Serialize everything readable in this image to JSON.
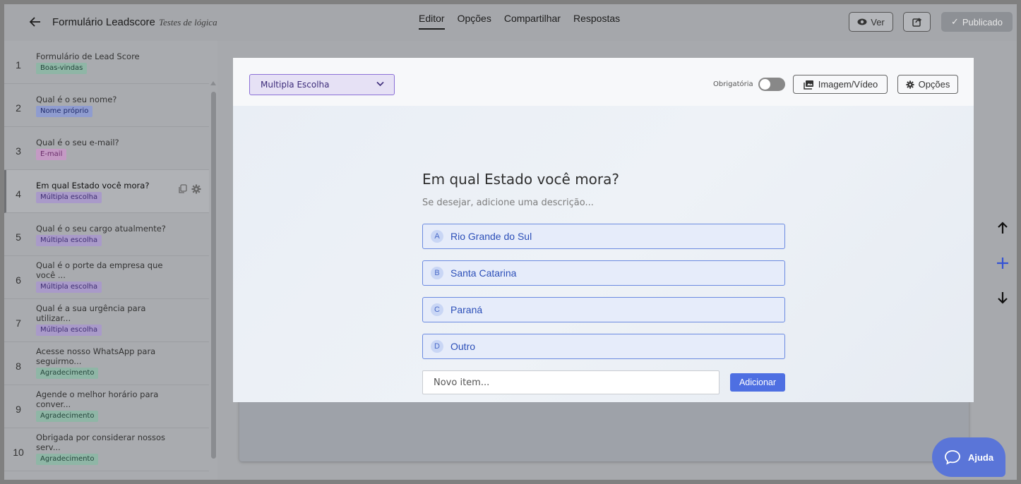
{
  "header": {
    "title": "Formulário Leadscore",
    "subtitle": "Testes de lógica",
    "tabs": [
      {
        "label": "Editor"
      },
      {
        "label": "Opções"
      },
      {
        "label": "Compartilhar"
      },
      {
        "label": "Respostas"
      }
    ],
    "view_label": "Ver",
    "published_label": "Publicado"
  },
  "sidebar": {
    "items": [
      {
        "num": "1",
        "title": "Formulário de Lead Score",
        "badge": "Boas-vindas"
      },
      {
        "num": "2",
        "title": "Qual é o seu nome?",
        "badge": "Nome próprio"
      },
      {
        "num": "3",
        "title": "Qual é o seu e-mail?",
        "badge": "E-mail"
      },
      {
        "num": "4",
        "title": "Em qual Estado você mora?",
        "badge": "Múltipla escolha"
      },
      {
        "num": "5",
        "title": "Qual é o seu cargo atualmente?",
        "badge": "Múltipla escolha"
      },
      {
        "num": "6",
        "title": "Qual é o porte da empresa que você ...",
        "badge": "Múltipla escolha"
      },
      {
        "num": "7",
        "title": "Qual é a sua urgência para utilizar...",
        "badge": "Múltipla escolha"
      },
      {
        "num": "8",
        "title": "Acesse nosso WhatsApp para seguirmo...",
        "badge": "Agradecimento"
      },
      {
        "num": "9",
        "title": "Agende o melhor horário para conver...",
        "badge": "Agradecimento"
      },
      {
        "num": "10",
        "title": "Obrigada por considerar nossos serv...",
        "badge": "Agradecimento"
      }
    ]
  },
  "editor": {
    "type_selected": "Multipla Escolha",
    "required_label": "Obrigatória",
    "media_label": "Imagem/Vídeo",
    "options_label": "Opções",
    "question_title": "Em qual Estado você mora?",
    "question_desc": "Se desejar, adicione uma descrição...",
    "options": [
      {
        "letter": "A",
        "text": "Rio Grande do Sul"
      },
      {
        "letter": "B",
        "text": "Santa Catarina"
      },
      {
        "letter": "C",
        "text": "Paraná"
      },
      {
        "letter": "D",
        "text": "Outro"
      }
    ],
    "new_item_placeholder": "Novo item...",
    "add_label": "Adicionar"
  },
  "help": {
    "label": "Ajuda"
  },
  "colors": {
    "accent": "#4e6fe2",
    "select_border": "#8b6fd6",
    "option_border": "#6b8ae0"
  }
}
